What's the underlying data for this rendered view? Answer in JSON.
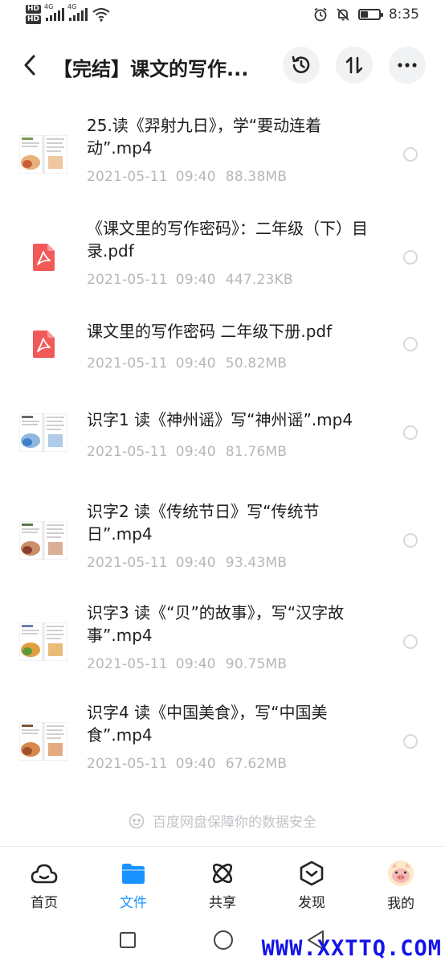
{
  "status_bar": {
    "hd1": "HD",
    "hd2": "HD",
    "net1": "4G",
    "net2": "4G",
    "time": "8:35",
    "battery_level": 0.4
  },
  "header": {
    "title": "【完结】课文的写作..."
  },
  "files": [
    {
      "name": "25.读《羿射九日》，学“要动连着动”.mp4",
      "date": "2021-05-11",
      "time": "09:40",
      "size": "88.38MB",
      "type": "video",
      "thumb": "book-red"
    },
    {
      "name": "《课文里的写作密码》：二年级（下）目录.pdf",
      "date": "2021-05-11",
      "time": "09:40",
      "size": "447.23KB",
      "type": "pdf"
    },
    {
      "name": "课文里的写作密码 二年级下册.pdf",
      "date": "2021-05-11",
      "time": "09:40",
      "size": "50.82MB",
      "type": "pdf"
    },
    {
      "name": "识字1 读《神州谣》写“神州谣”.mp4",
      "date": "2021-05-11",
      "time": "09:40",
      "size": "81.76MB",
      "type": "video",
      "thumb": "book-blue"
    },
    {
      "name": "识字2 读《传统节日》写“传统节日”.mp4",
      "date": "2021-05-11",
      "time": "09:40",
      "size": "93.43MB",
      "type": "video",
      "thumb": "book-brown"
    },
    {
      "name": "识字3 读《“贝”的故事》，写“汉字故事”.mp4",
      "date": "2021-05-11",
      "time": "09:40",
      "size": "90.75MB",
      "type": "video",
      "thumb": "book-green"
    },
    {
      "name": "识字4 读《中国美食》，写“中国美食”.mp4",
      "date": "2021-05-11",
      "time": "09:40",
      "size": "67.62MB",
      "type": "video",
      "thumb": "book-food"
    }
  ],
  "safety_note": "百度网盘保障你的数据安全",
  "tabs": [
    {
      "label": "首页",
      "icon": "cloud-icon",
      "active": false
    },
    {
      "label": "文件",
      "icon": "folder-icon",
      "active": true
    },
    {
      "label": "共享",
      "icon": "atom-icon",
      "active": false
    },
    {
      "label": "发现",
      "icon": "compass-icon",
      "active": false
    },
    {
      "label": "我的",
      "icon": "avatar-icon",
      "active": false
    }
  ],
  "watermark": "WWW.XXTTQ.COM",
  "colors": {
    "accent": "#1a92ff",
    "pdf_red": "#f25a5a",
    "meta_gray": "#b5b7bb",
    "watermark": "#1414e8"
  }
}
